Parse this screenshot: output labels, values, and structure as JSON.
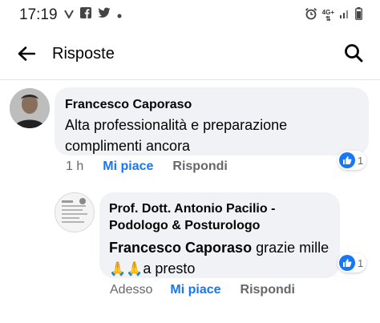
{
  "status_bar": {
    "time": "17:19",
    "left_icons": [
      "v-app-icon",
      "facebook-icon",
      "twitter-icon",
      "notification-dot-icon"
    ],
    "right_icons": [
      "alarm-icon",
      "4g-network-icon",
      "signal-icon",
      "battery-icon"
    ],
    "network_top": "4G+",
    "network_bottom": "⇅"
  },
  "header": {
    "title": "Risposte",
    "back_icon": "arrow-left-icon",
    "search_icon": "search-icon"
  },
  "comments": [
    {
      "author": "Francesco Caporaso",
      "text": "Alta professionalità e preparazione complimenti ancora",
      "time": "1 h",
      "like_label": "Mi piace",
      "reply_label": "Rispondi",
      "reaction_count": "1",
      "reaction_icon": "like-icon"
    },
    {
      "author": "Prof. Dott. Antonio Pacilio - Podologo & Posturologo",
      "mention": "Francesco Caporaso",
      "text_after_mention": " grazie mille",
      "emoji": "🙏🙏",
      "text_end": "a presto",
      "time": "Adesso",
      "like_label": "Mi piace",
      "reply_label": "Rispondi",
      "reaction_count": "1",
      "reaction_icon": "like-icon"
    }
  ],
  "colors": {
    "accent": "#1877f2",
    "bubble": "#f0f2f5",
    "secondary_text": "#65676b",
    "primary_text": "#050505"
  }
}
